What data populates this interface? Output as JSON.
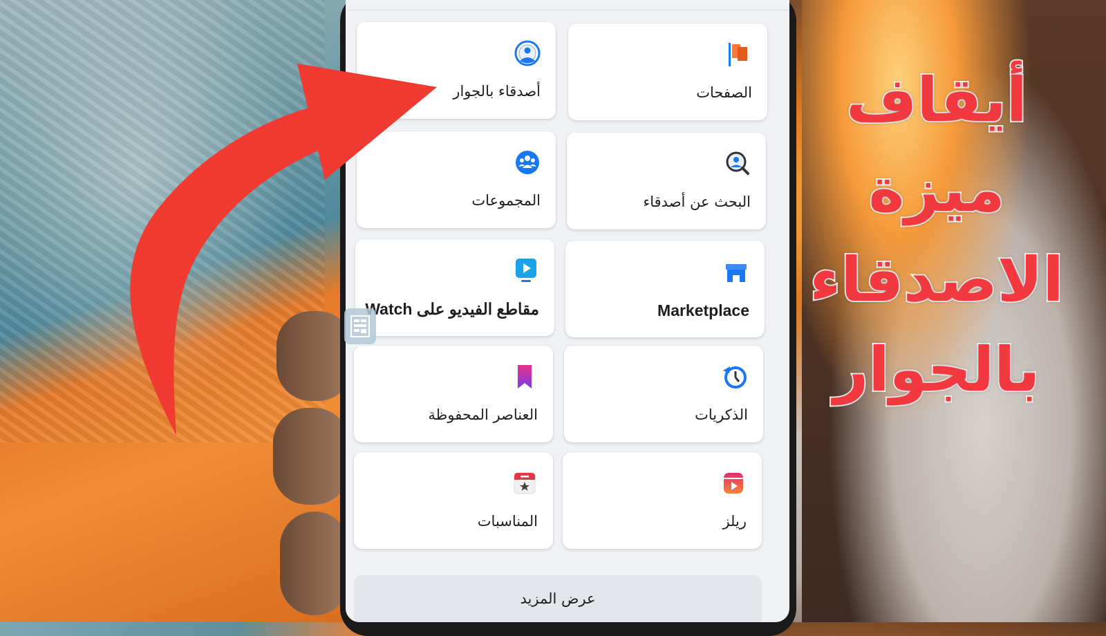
{
  "menu": {
    "tiles": [
      {
        "id": "pages",
        "label": "الصفحات",
        "icon": "flag-icon",
        "color": "#f26f21"
      },
      {
        "id": "nearby-friends",
        "label": "أصدقاء بالجوار",
        "icon": "nearby-friends-icon",
        "color": "#1877f2"
      },
      {
        "id": "find-friends",
        "label": "البحث عن أصدقاء",
        "icon": "find-friends-icon",
        "color": "#1877f2"
      },
      {
        "id": "groups",
        "label": "المجموعات",
        "icon": "groups-icon",
        "color": "#1877f2"
      },
      {
        "id": "marketplace",
        "label": "Marketplace",
        "icon": "store-icon",
        "color": "#1877f2"
      },
      {
        "id": "watch",
        "label": "مقاطع الفيديو على Watch",
        "icon": "video-icon",
        "color": "#1877f2"
      },
      {
        "id": "memories",
        "label": "الذكريات",
        "icon": "memories-clock-icon",
        "color": "#1877f2"
      },
      {
        "id": "saved",
        "label": "العناصر المحفوظة",
        "icon": "bookmark-icon",
        "color": "#9b2fd6"
      },
      {
        "id": "reels",
        "label": "ريلز",
        "icon": "reels-icon",
        "color": "#f25c3a"
      },
      {
        "id": "events",
        "label": "المناسبات",
        "icon": "calendar-star-icon",
        "color": "#e0384a"
      }
    ],
    "see_more_label": "عرض المزيد"
  },
  "overlay": {
    "title_lines": [
      "أيقاف",
      "ميزة",
      "الاصدقاء",
      "بالجوار"
    ],
    "title_color": "#f2393f",
    "arrow_color": "#f03a32"
  }
}
